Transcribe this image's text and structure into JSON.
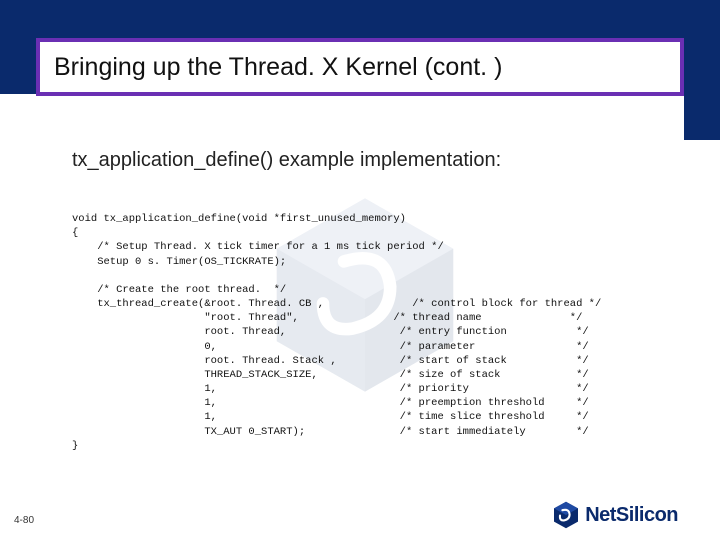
{
  "slide": {
    "title": "Bringing up the Thread. X Kernel (cont. )",
    "subtitle": "tx_application_define() example implementation:",
    "page_number": "4-80",
    "brand_name": "NetSilicon"
  },
  "code_lines": [
    "void tx_application_define(void *first_unused_memory)",
    "{",
    "    /* Setup Thread. X tick timer for a 1 ms tick period */",
    "    Setup 0 s. Timer(OS_TICKRATE);",
    "",
    "    /* Create the root thread.  */",
    "    tx_thread_create(&root. Thread. CB ,              /* control block for thread */",
    "                     \"root. Thread\",               /* thread name              */",
    "                     root. Thread,                  /* entry function           */",
    "                     0,                             /* parameter                */",
    "                     root. Thread. Stack ,          /* start of stack           */",
    "                     THREAD_STACK_SIZE,             /* size of stack            */",
    "                     1,                             /* priority                 */",
    "                     1,                             /* preemption threshold     */",
    "                     1,                             /* time slice threshold     */",
    "                     TX_AUT 0_START);               /* start immediately        */",
    "}"
  ]
}
